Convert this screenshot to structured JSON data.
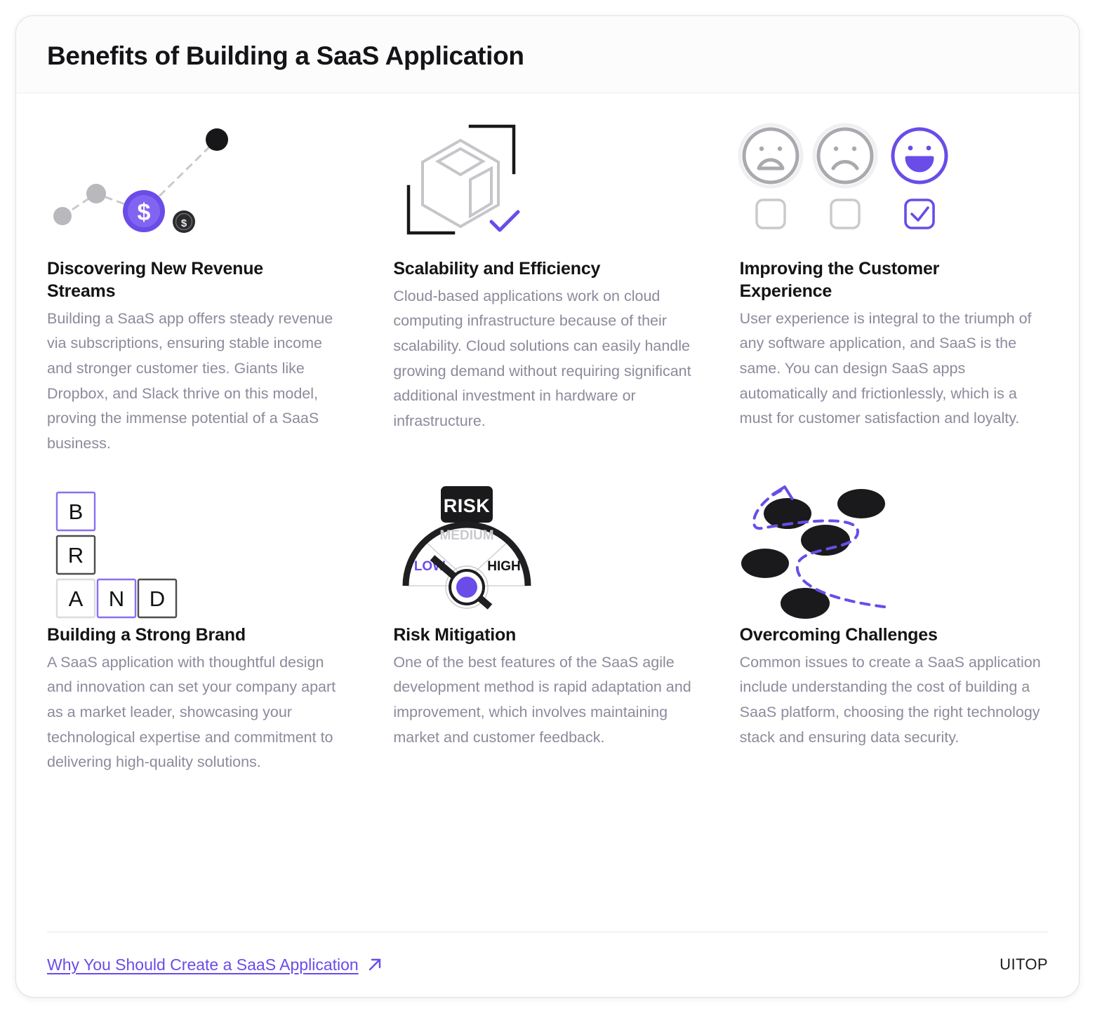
{
  "header": {
    "title": "Benefits of Building a SaaS Application"
  },
  "colors": {
    "accent": "#6a4ce8",
    "accent_light": "#8b6ff2",
    "title_text": "#141417",
    "body_text": "#8b8b9c",
    "dark": "#1e1e20",
    "gray_line": "#c9c9ce",
    "card_border": "#e3e3e6"
  },
  "items": [
    {
      "icon": "revenue-chart-icon",
      "title": "Discovering New Revenue Streams",
      "body": "Building a SaaS app offers steady revenue via subscriptions, ensuring stable income and stronger customer ties. Giants like Dropbox, and Slack thrive on this model, proving the immense potential of a SaaS business."
    },
    {
      "icon": "cube-scalability-icon",
      "title": "Scalability and Efficiency",
      "body": "Cloud-based applications work on cloud computing infrastructure because of their scalability. Cloud solutions can easily handle growing demand without requiring significant additional investment in hardware or infrastructure."
    },
    {
      "icon": "satisfaction-faces-icon",
      "title": "Improving the Customer Experience",
      "body": "User experience is integral to the triumph of any software application, and SaaS is the same. You can design SaaS apps automatically and frictionlessly, which is a must for customer satisfaction and loyalty."
    },
    {
      "icon": "brand-letters-icon",
      "title": "Building a Strong Brand",
      "body": "A SaaS application with thoughtful design and innovation can set your company apart as a market leader, showcasing your technological expertise and commitment to delivering high-quality solutions."
    },
    {
      "icon": "risk-gauge-icon",
      "title": "Risk Mitigation",
      "body": "One of the best features of the SaaS agile development method is rapid adaptation and improvement, which involves maintaining market and customer feedback."
    },
    {
      "icon": "winding-path-obstacles-icon",
      "title": "Overcoming Challenges",
      "body": "Common issues to create a SaaS application include understanding the cost of building a SaaS platform, choosing the right technology stack and ensuring data security."
    }
  ],
  "icon_labels": {
    "coin_symbol": "$",
    "small_coin_symbol": "$",
    "brand_letters": [
      "B",
      "R",
      "A",
      "N",
      "D"
    ],
    "risk_badge": "RISK",
    "gauge_low": "LOW",
    "gauge_medium": "MEDIUM",
    "gauge_high": "HIGH"
  },
  "footer": {
    "link_label": "Why You Should Create a SaaS Application",
    "link_icon": "arrow-up-right-icon",
    "logo": "UITOP"
  }
}
